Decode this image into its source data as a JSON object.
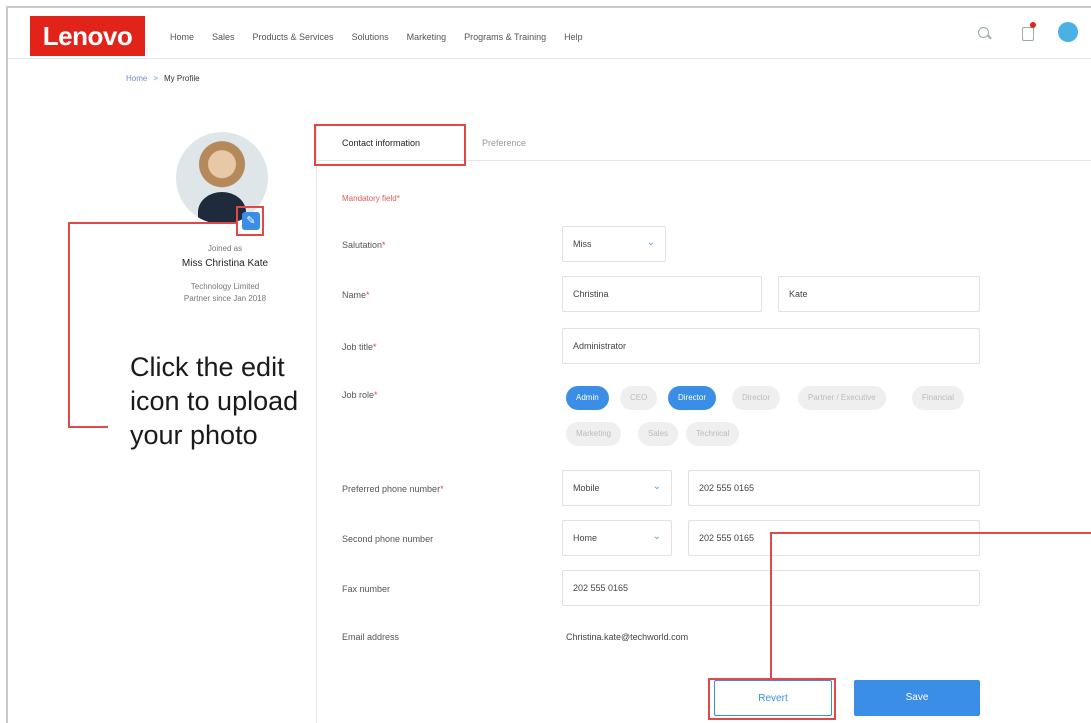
{
  "header": {
    "logo_text": "Lenovo",
    "nav": [
      "Home",
      "Sales",
      "Products & Services",
      "Solutions",
      "Marketing",
      "Programs & Training",
      "Help"
    ]
  },
  "breadcrumb": {
    "home": "Home",
    "separator": ">",
    "current": "My Profile"
  },
  "profile": {
    "joined_label": "Joined as",
    "name": "Miss Christina Kate",
    "company": "Technology Limited",
    "partner_since": "Partner since Jan 2018"
  },
  "callout": {
    "text": "Click the edit icon to upload your photo"
  },
  "tabs": {
    "contact": "Contact information",
    "preference": "Preference"
  },
  "form": {
    "mandatory_note": "Mandatory field*",
    "salutation": {
      "label": "Salutation",
      "value": "Miss"
    },
    "name": {
      "label": "Name",
      "first": "Christina",
      "last": "Kate"
    },
    "job_title": {
      "label": "Job title",
      "value": "Administrator"
    },
    "job_role": {
      "label": "Job role",
      "options": [
        "Admin",
        "CEO",
        "Director",
        "Director",
        "Partner / Executive",
        "Financial",
        "Marketing",
        "Sales",
        "Technical"
      ],
      "selected": [
        "Admin",
        "Director"
      ]
    },
    "preferred_phone": {
      "label": "Preferred phone number",
      "type": "Mobile",
      "value": "202 555 0165"
    },
    "second_phone": {
      "label": "Second phone number",
      "type": "Home",
      "value": "202 555 0165"
    },
    "fax": {
      "label": "Fax number",
      "value": "202 555 0165"
    },
    "email": {
      "label": "Email address",
      "value": "Christina.kate@techworld.com"
    },
    "required_mark": "*"
  },
  "buttons": {
    "revert": "Revert",
    "save": "Save"
  },
  "colors": {
    "brand": "#e2231a",
    "accent": "#3a8ee6",
    "highlight": "#e04848"
  }
}
